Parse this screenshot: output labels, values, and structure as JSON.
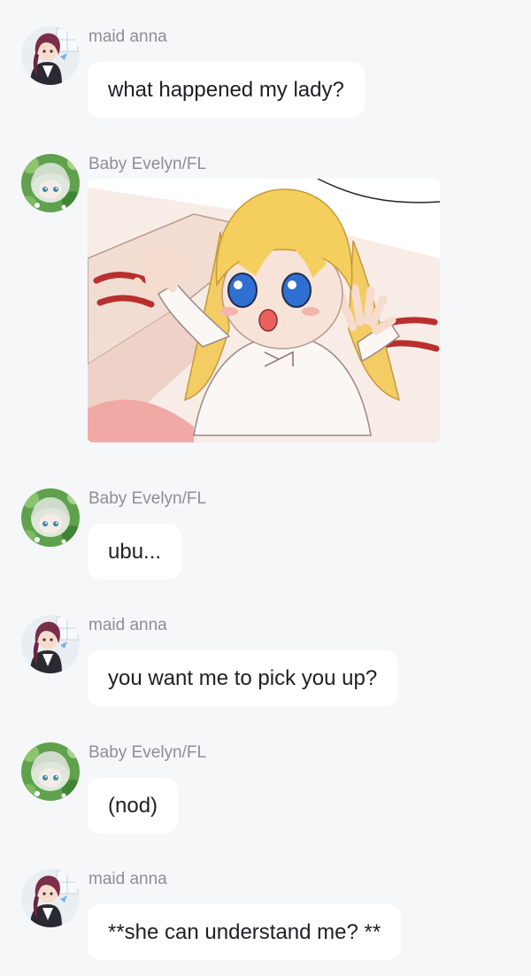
{
  "colors": {
    "background": "#f6f7f9",
    "bubble": "#ffffff",
    "author_text": "#8c8f95",
    "message_text": "#1f1f22"
  },
  "messages": [
    {
      "author": "maid anna",
      "avatar": "maid-anna-avatar",
      "type": "text",
      "text": "what happened my lady?"
    },
    {
      "author": "Baby Evelyn/FL",
      "avatar": "baby-evelyn-avatar",
      "type": "image",
      "image": "chibi-blonde-girl-reaching-up-illustration"
    },
    {
      "author": "Baby Evelyn/FL",
      "avatar": "baby-evelyn-avatar",
      "type": "text",
      "text": "ubu..."
    },
    {
      "author": "maid anna",
      "avatar": "maid-anna-avatar",
      "type": "text",
      "text": "you want me to pick you up?"
    },
    {
      "author": "Baby Evelyn/FL",
      "avatar": "baby-evelyn-avatar",
      "type": "text",
      "text": "(nod)"
    },
    {
      "author": "maid anna",
      "avatar": "maid-anna-avatar",
      "type": "text",
      "text": "**she can understand me? **"
    }
  ]
}
